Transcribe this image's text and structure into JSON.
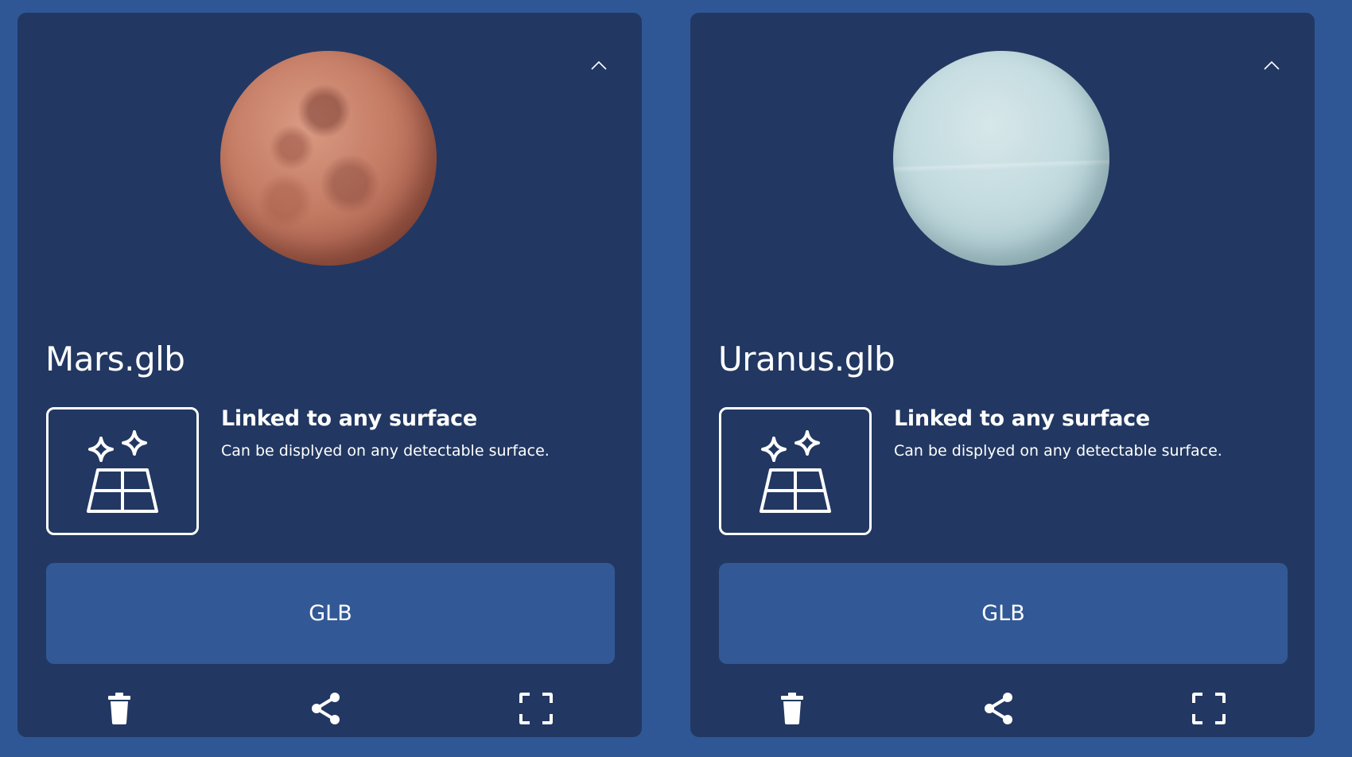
{
  "colors": {
    "background": "#2f5796",
    "card": "#223862",
    "button": "#325996",
    "text": "#ffffff"
  },
  "cards": [
    {
      "planet": "mars",
      "file_name": "Mars.glb",
      "surface_title": "Linked to any surface",
      "surface_description": "Can be displyed on any detectable surface.",
      "format_label": "GLB",
      "icons": {
        "collapse": "chevron-up-icon",
        "surface": "ar-surface-sparkle-icon",
        "delete": "trash-icon",
        "share": "share-icon",
        "fullscreen": "fullscreen-icon"
      }
    },
    {
      "planet": "uranus",
      "file_name": "Uranus.glb",
      "surface_title": "Linked to any surface",
      "surface_description": "Can be displyed on any detectable surface.",
      "format_label": "GLB",
      "icons": {
        "collapse": "chevron-up-icon",
        "surface": "ar-surface-sparkle-icon",
        "delete": "trash-icon",
        "share": "share-icon",
        "fullscreen": "fullscreen-icon"
      }
    }
  ]
}
